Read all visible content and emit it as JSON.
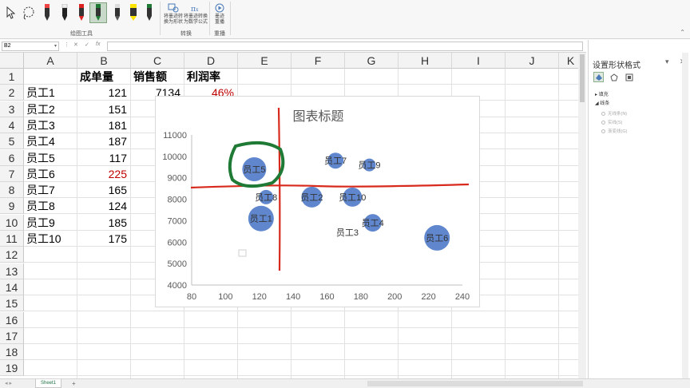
{
  "ribbon": {
    "group_labels": {
      "draw_tools": "绘图工具",
      "convert": "转换",
      "replay": "重播"
    },
    "buttons": {
      "ink_to_shape": "将墨迹转\n换为形状",
      "ink_to_math": "将墨迹转换\n为数学公式",
      "ink_replay": "墨迹\n重播"
    }
  },
  "formula_bar": {
    "name_box": "B2",
    "fx": "fx",
    "content": ""
  },
  "columns": [
    "A",
    "B",
    "C",
    "D",
    "E",
    "F",
    "G",
    "H",
    "I",
    "J",
    "K"
  ],
  "rows": [
    "1",
    "2",
    "3",
    "4",
    "5",
    "6",
    "7",
    "8",
    "9",
    "10",
    "11",
    "12",
    "13",
    "14",
    "15",
    "16",
    "17",
    "18",
    "19"
  ],
  "table": {
    "headers": {
      "b": "成单量",
      "c": "销售额",
      "d": "利润率"
    },
    "a": [
      "员工1",
      "员工2",
      "员工3",
      "员工4",
      "员工5",
      "员工6",
      "员工7",
      "员工8",
      "员工9",
      "员工10"
    ],
    "b": [
      "121",
      "151",
      "181",
      "187",
      "117",
      "225",
      "165",
      "124",
      "185",
      "175"
    ],
    "c2": "7134",
    "d2": "46%"
  },
  "chart_data": {
    "type": "scatter",
    "title": "图表标题",
    "xlim": [
      80,
      240
    ],
    "ylim": [
      4000,
      11000
    ],
    "x_ticks": [
      "80",
      "100",
      "120",
      "140",
      "160",
      "180",
      "200",
      "220",
      "240"
    ],
    "y_ticks": [
      "4000",
      "5000",
      "6000",
      "7000",
      "8000",
      "9000",
      "10000",
      "11000"
    ],
    "points": [
      {
        "label": "员工1",
        "x": 121,
        "y": 7100,
        "r": 16
      },
      {
        "label": "员工2",
        "x": 151,
        "y": 8100,
        "r": 13
      },
      {
        "label": "员工3",
        "x": 172,
        "y": 6450,
        "r": 0
      },
      {
        "label": "员工4",
        "x": 187,
        "y": 6900,
        "r": 11
      },
      {
        "label": "员工5",
        "x": 117,
        "y": 9400,
        "r": 15
      },
      {
        "label": "员工6",
        "x": 225,
        "y": 6200,
        "r": 16
      },
      {
        "label": "员工7",
        "x": 165,
        "y": 9800,
        "r": 10
      },
      {
        "label": "员工8",
        "x": 124,
        "y": 8100,
        "r": 9
      },
      {
        "label": "员工9",
        "x": 185,
        "y": 9600,
        "r": 8
      },
      {
        "label": "员工10",
        "x": 175,
        "y": 8100,
        "r": 12
      }
    ],
    "bubble_color": "#4472c4"
  },
  "pane": {
    "title": "设置形状格式",
    "sections": {
      "fill": "填充",
      "line": "线条"
    },
    "line_options": [
      "无线条(N)",
      "实线(S)",
      "渐变线(G)"
    ]
  },
  "status": {
    "sheet": "Sheet1",
    "add": "+"
  },
  "colors": {
    "ink_red": "#d82a1c",
    "ink_green": "#1f7a35",
    "red_text": "#c00000"
  }
}
